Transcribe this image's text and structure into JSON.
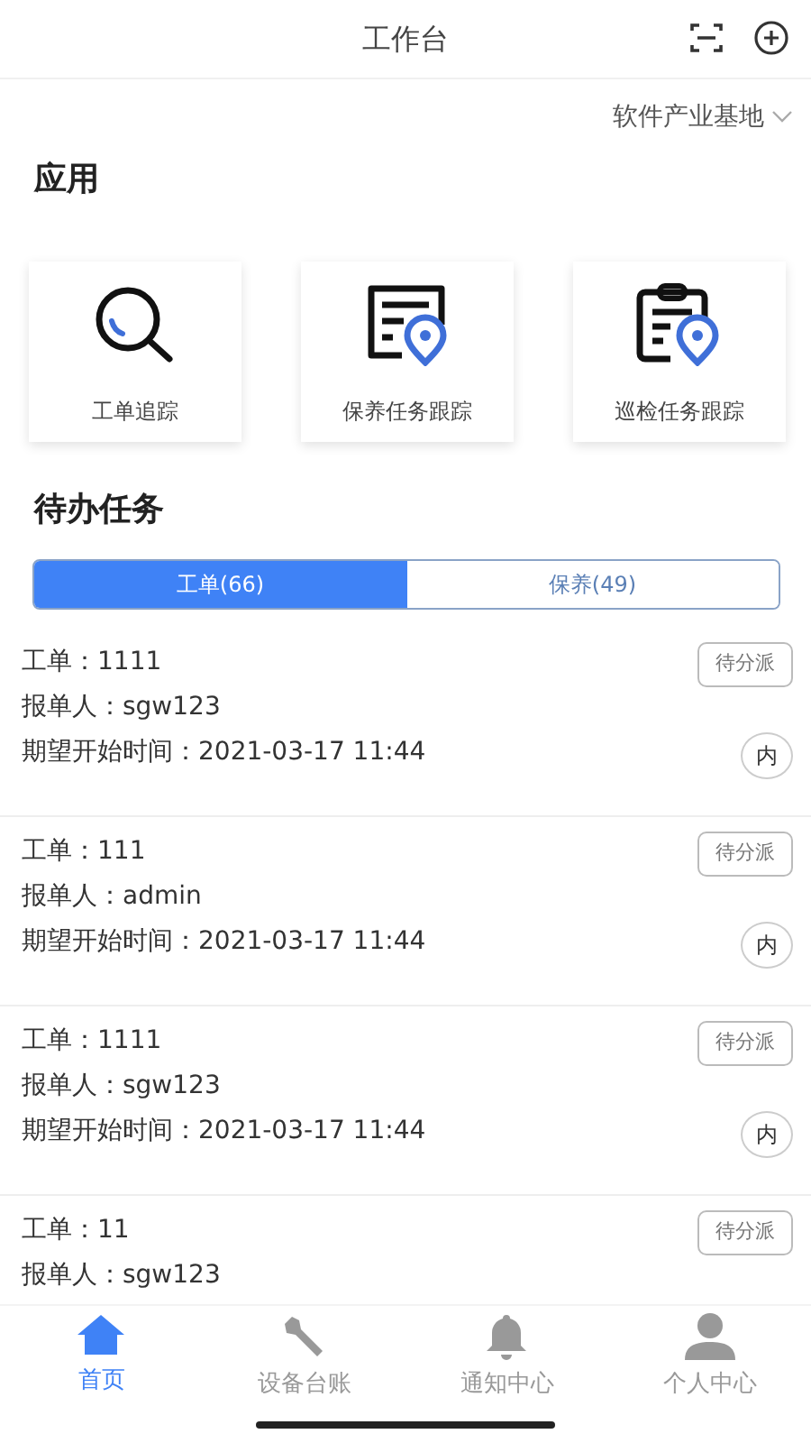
{
  "header": {
    "title": "工作台"
  },
  "location": "软件产业基地",
  "apps_title": "应用",
  "apps": [
    {
      "kind": "search",
      "label": "工单追踪"
    },
    {
      "kind": "doc",
      "label": "保养任务跟踪"
    },
    {
      "kind": "clipboard",
      "label": "巡检任务跟踪"
    }
  ],
  "tasks_title": "待办任务",
  "tabs": [
    {
      "label": "工单(66)",
      "selected": true
    },
    {
      "label": "保养(49)",
      "selected": false
    }
  ],
  "tasks": [
    {
      "lines": [
        "工单：1111",
        "报单人：sgw123",
        "期望开始时间：2021-03-17 11:44"
      ],
      "status": "待分派",
      "tag": "内"
    },
    {
      "lines": [
        "工单：111",
        "报单人：admin",
        "期望开始时间：2021-03-17 11:44"
      ],
      "status": "待分派",
      "tag": "内"
    },
    {
      "lines": [
        "工单：1111",
        "报单人：sgw123",
        "期望开始时间：2021-03-17 11:44"
      ],
      "status": "待分派",
      "tag": "内"
    },
    {
      "lines": [
        "工单：11",
        "报单人：sgw123"
      ],
      "status": "待分派"
    }
  ],
  "nav": [
    {
      "kind": "home",
      "label": "首页",
      "selected": true
    },
    {
      "kind": "wrench",
      "label": "设备台账",
      "selected": false
    },
    {
      "kind": "bell",
      "label": "通知中心",
      "selected": false
    },
    {
      "kind": "person",
      "label": "个人中心",
      "selected": false
    }
  ]
}
